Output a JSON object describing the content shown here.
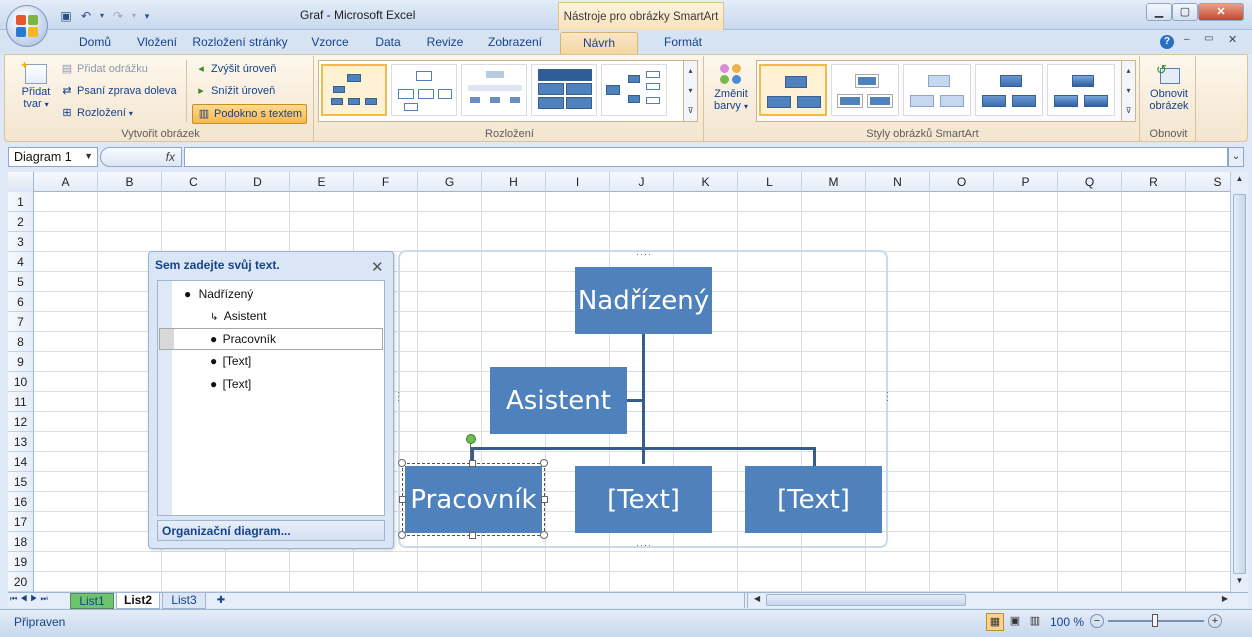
{
  "window": {
    "title": "Graf - Microsoft Excel",
    "context_tab_title": "Nástroje pro obrázky SmartArt"
  },
  "ribbon": {
    "tabs": [
      "Domů",
      "Vložení",
      "Rozložení stránky",
      "Vzorce",
      "Data",
      "Revize",
      "Zobrazení",
      "Návrh",
      "Formát"
    ],
    "active_tab": "Návrh",
    "group_create": {
      "label": "Vytvořit obrázek",
      "add_shape": "Přidat",
      "add_shape2": "tvar",
      "add_bullet": "Přidat odrážku",
      "rtl": "Psaní zprava doleva",
      "layout": "Rozložení",
      "promote": "Zvýšit úroveň",
      "demote": "Snížit úroveň",
      "text_pane": "Podokno s textem"
    },
    "group_layouts": {
      "label": "Rozložení"
    },
    "group_styles": {
      "label": "Styly obrázků SmartArt",
      "change_colors": "Změnit",
      "change_colors2": "barvy"
    },
    "group_reset": {
      "label": "Obnovit",
      "reset_graphic": "Obnovit",
      "reset_graphic2": "obrázek"
    }
  },
  "formula_bar": {
    "name_box": "Diagram 1",
    "fx": "fx",
    "value": ""
  },
  "sheet": {
    "columns": [
      "A",
      "B",
      "C",
      "D",
      "E",
      "F",
      "G",
      "H",
      "I",
      "J",
      "K",
      "L",
      "M",
      "N",
      "O",
      "P",
      "Q",
      "R",
      "S"
    ],
    "rows": [
      "1",
      "2",
      "3",
      "4",
      "5",
      "6",
      "7",
      "8",
      "9",
      "10",
      "11",
      "12",
      "13",
      "14",
      "15",
      "16",
      "17",
      "18",
      "19",
      "20"
    ]
  },
  "text_pane": {
    "title": "Sem zadejte svůj text.",
    "items": [
      "Nadřízený",
      "Asistent",
      "Pracovník",
      "[Text]",
      "[Text]"
    ],
    "footer": "Organizační diagram..."
  },
  "smartart": {
    "boxes": [
      "Nadřízený",
      "Asistent",
      "Pracovník",
      "[Text]",
      "[Text]"
    ],
    "box_color": "#4f81bd",
    "line_color": "#385d8a"
  },
  "sheet_tabs": [
    "List1",
    "List2",
    "List3"
  ],
  "active_sheet": "List2",
  "status": {
    "text": "Připraven",
    "zoom": "100 %"
  }
}
